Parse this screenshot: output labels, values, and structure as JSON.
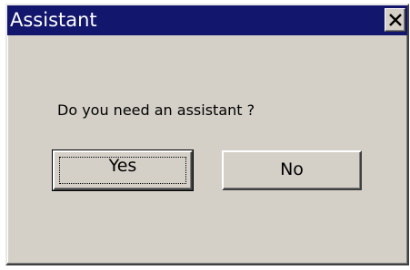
{
  "window": {
    "title": "Assistant",
    "close_label": "X"
  },
  "message": "Do you need an assistant ?",
  "buttons": {
    "yes_label": "Yes",
    "no_label": "No"
  },
  "colors": {
    "titlebar": "#12166c",
    "dialog_face": "#d4d0c8"
  }
}
